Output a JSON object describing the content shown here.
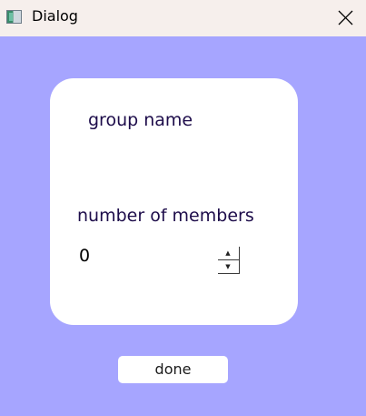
{
  "window": {
    "title": "Dialog",
    "icon": "app-window-icon",
    "close_icon": "close-icon"
  },
  "colors": {
    "titlebar_bg": "#f6efec",
    "content_bg": "#a6a5ff",
    "card_bg": "#ffffff",
    "label_color": "#1d0c4a"
  },
  "form": {
    "group_name_label": "group name",
    "group_name_value": "",
    "members_label": "number of members",
    "members_value": "0",
    "spin_up_glyph": "▲",
    "spin_down_glyph": "▼"
  },
  "actions": {
    "done_label": "done"
  }
}
